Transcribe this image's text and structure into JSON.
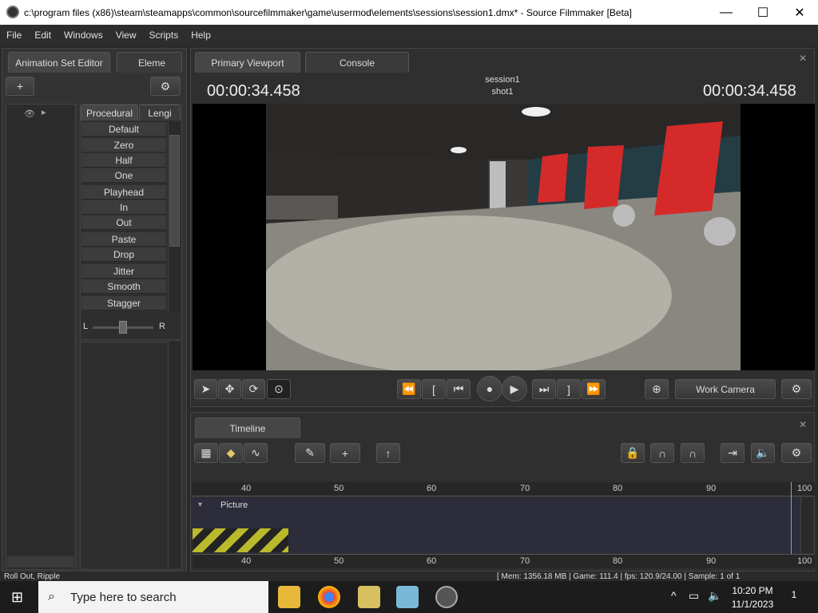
{
  "window": {
    "title": "c:\\program files (x86)\\steam\\steamapps\\common\\sourcefilmmaker\\game\\usermod\\elements\\sessions\\session1.dmx* - Source Filmmaker [Beta]",
    "min": "—",
    "max": "☐",
    "close": "✕"
  },
  "menu": [
    "File",
    "Edit",
    "Windows",
    "View",
    "Scripts",
    "Help"
  ],
  "left": {
    "tab1": "Animation Set Editor",
    "tab2": "Eleme",
    "add": "+",
    "gear": "⚙",
    "subtab1": "Procedural",
    "subtab2": "Lengi",
    "buttons": [
      "Default",
      "Zero",
      "Half",
      "One",
      "Playhead",
      "In",
      "Out",
      "Paste",
      "Drop",
      "Jitter",
      "Smooth",
      "Stagger"
    ],
    "slider_l": "L",
    "slider_r": "R",
    "slider_value": 0.5
  },
  "viewport": {
    "tab1": "Primary Viewport",
    "tab2": "Console",
    "tc_left": "00:00:34.458",
    "tc_right": "00:00:34.458",
    "session": "session1",
    "shot": "shot1",
    "camera": "Work Camera"
  },
  "timeline": {
    "tab": "Timeline",
    "track": "Picture",
    "ticks": [
      "40",
      "50",
      "60",
      "70",
      "80",
      "90",
      "100"
    ]
  },
  "status": {
    "left": "Roll Out, Ripple",
    "right": "[ Mem: 1356.18 MB | Game: 111.4 | fps: 120.9/24.00 | Sample: 1 of 1"
  },
  "taskbar": {
    "search": "Type here to search",
    "time": "10:20 PM",
    "date": "11/1/2023",
    "notif": "1"
  },
  "colors": {
    "bg": "#2a2a2a",
    "panel": "#333333",
    "accent": "#ddd"
  }
}
